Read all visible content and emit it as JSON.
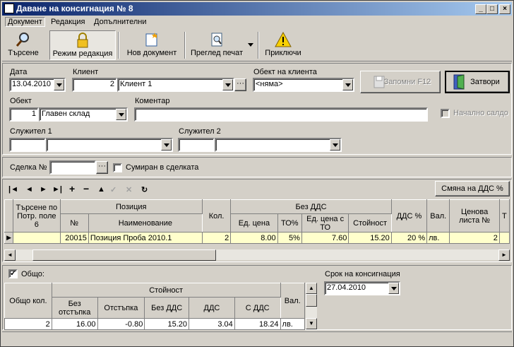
{
  "window": {
    "title": "Даване на консигнация № 8"
  },
  "menu": {
    "items": [
      "Документ",
      "Редакция",
      "Допълнителни"
    ]
  },
  "toolbar": {
    "search": "Търсене",
    "edit_mode": "Режим редакция",
    "new_doc": "Нов документ",
    "print_preview": "Преглед печат",
    "finish": "Приключи"
  },
  "form": {
    "date_label": "Дата",
    "date_value": "13.04.2010",
    "client_label": "Клиент",
    "client_code": "2",
    "client_name": "Клиент 1",
    "client_object_label": "Обект на клиента",
    "client_object_value": "<няма>",
    "save_label": "Запомни F12",
    "close_label": "Затвори",
    "object_label": "Обект",
    "object_code": "1",
    "object_name": "Главен склад",
    "comment_label": "Коментар",
    "comment_value": "",
    "initial_balance_label": "Начално салдо",
    "employee1_label": "Служител 1",
    "employee2_label": "Служител 2"
  },
  "deal": {
    "label": "Сделка №",
    "value": "",
    "summed_label": "Сумиран в сделката"
  },
  "grid": {
    "vat_change_label": "Смяна на ДДС %",
    "headers": {
      "search": "Търсене по Потр. поле 6",
      "position": "Позиция",
      "no": "№",
      "name": "Наименование",
      "qty": "Кол.",
      "no_vat": "Без ДДС",
      "unit_price": "Ед. цена",
      "to": "ТО%",
      "unit_price_to": "Ед. цена с ТО",
      "value": "Стойност",
      "vat": "ДДС %",
      "cur": "Вал.",
      "price_list": "Ценова листа №",
      "t": "Т"
    },
    "rows": [
      {
        "search": "",
        "no": "20015",
        "name": "Позиция Проба 2010.1",
        "qty": "2",
        "unit_price": "8.00",
        "to": "5%",
        "unit_price_to": "7.60",
        "value": "15.20",
        "vat": "20 %",
        "cur": "лв.",
        "price_list": "2"
      }
    ]
  },
  "totals": {
    "label": "Общо:",
    "headers": {
      "qty": "Общо кол.",
      "value": "Стойност",
      "no_discount": "Без отстъпка",
      "discount": "Отстъпка",
      "no_vat": "Без ДДС",
      "vat": "ДДС",
      "with_vat": "С ДДС",
      "cur": "Вал."
    },
    "row": {
      "qty": "2",
      "no_discount": "16.00",
      "discount": "-0.80",
      "no_vat": "15.20",
      "vat": "3.04",
      "with_vat": "18.24",
      "cur": "лв."
    }
  },
  "consignment": {
    "label": "Срок на консигнация",
    "value": "27.04.2010"
  }
}
